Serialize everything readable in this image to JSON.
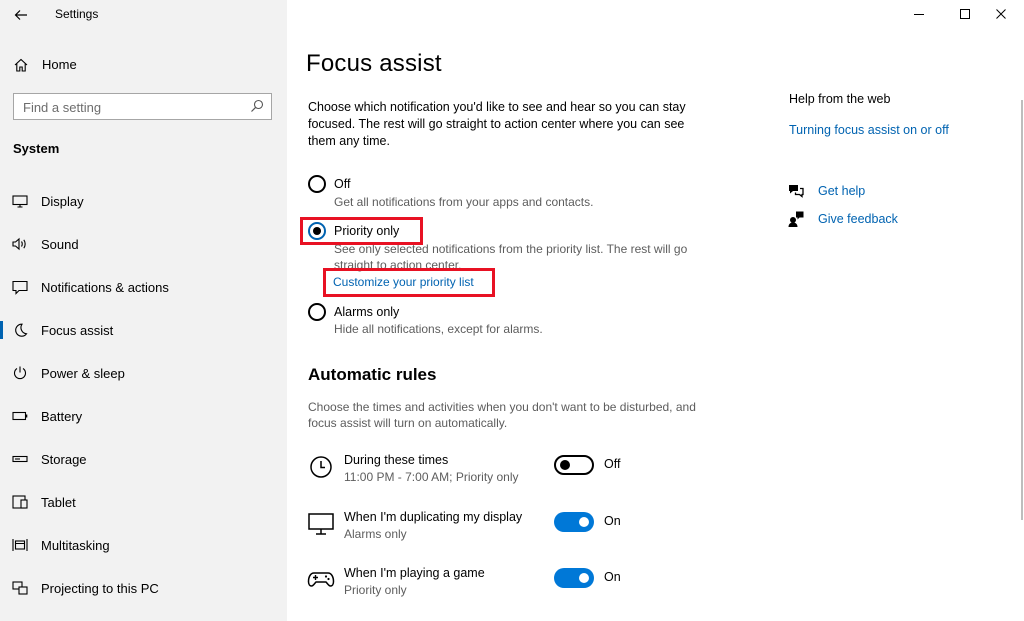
{
  "window": {
    "app_title": "Settings",
    "controls": {
      "minimize": "minimize",
      "maximize": "maximize",
      "close": "close"
    }
  },
  "sidebar": {
    "home_label": "Home",
    "search_placeholder": "Find a setting",
    "section_label": "System",
    "items": [
      {
        "label": "Display",
        "icon": "display-icon"
      },
      {
        "label": "Sound",
        "icon": "sound-icon"
      },
      {
        "label": "Notifications & actions",
        "icon": "notifications-icon"
      },
      {
        "label": "Focus assist",
        "icon": "moon-icon",
        "active": true
      },
      {
        "label": "Power & sleep",
        "icon": "power-icon"
      },
      {
        "label": "Battery",
        "icon": "battery-icon"
      },
      {
        "label": "Storage",
        "icon": "storage-icon"
      },
      {
        "label": "Tablet",
        "icon": "tablet-icon"
      },
      {
        "label": "Multitasking",
        "icon": "multitasking-icon"
      },
      {
        "label": "Projecting to this PC",
        "icon": "projecting-icon"
      }
    ]
  },
  "main": {
    "title": "Focus assist",
    "intro": "Choose which notification you'd like to see and hear so you can stay focused. The rest will go straight to action center where you can see them any time.",
    "options": [
      {
        "label": "Off",
        "description": "Get all notifications from your apps and contacts.",
        "checked": false
      },
      {
        "label": "Priority only",
        "description": "See only selected notifications from the priority list. The rest will go straight to action center.",
        "checked": true
      },
      {
        "label": "Alarms only",
        "description": "Hide all notifications, except for alarms.",
        "checked": false
      }
    ],
    "customize_link": "Customize your priority list",
    "highlight_color": "#e81123",
    "rules": {
      "title": "Automatic rules",
      "description": "Choose the times and activities when you don't want to be disturbed, and focus assist will turn on automatically.",
      "items": [
        {
          "title": "During these times",
          "subtitle": "11:00 PM - 7:00 AM; Priority only",
          "state": "Off",
          "on": false,
          "icon": "clock-icon"
        },
        {
          "title": "When I'm duplicating my display",
          "subtitle": "Alarms only",
          "state": "On",
          "on": true,
          "icon": "monitor-icon"
        },
        {
          "title": "When I'm playing a game",
          "subtitle": "Priority only",
          "state": "On",
          "on": true,
          "icon": "gamepad-icon"
        }
      ]
    }
  },
  "help": {
    "title": "Help from the web",
    "link": "Turning focus assist on or off",
    "get_help": "Get help",
    "give_feedback": "Give feedback"
  },
  "colors": {
    "accent": "#0078d7",
    "link": "#0063b1",
    "sidebar_bg": "#f2f2f2"
  }
}
